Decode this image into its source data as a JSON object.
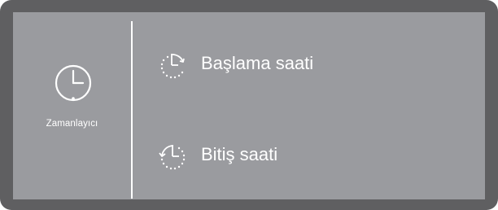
{
  "timer_tile": {
    "label": "Zamanlayıcı",
    "icon": "clock-icon"
  },
  "menu": {
    "items": [
      {
        "label": "Başlama saati",
        "icon": "start-time-icon"
      },
      {
        "label": "Bitiş saati",
        "icon": "end-time-icon"
      }
    ]
  },
  "colors": {
    "frame": "#5f5f61",
    "panel": "#9a9b9f",
    "text": "#ffffff"
  }
}
